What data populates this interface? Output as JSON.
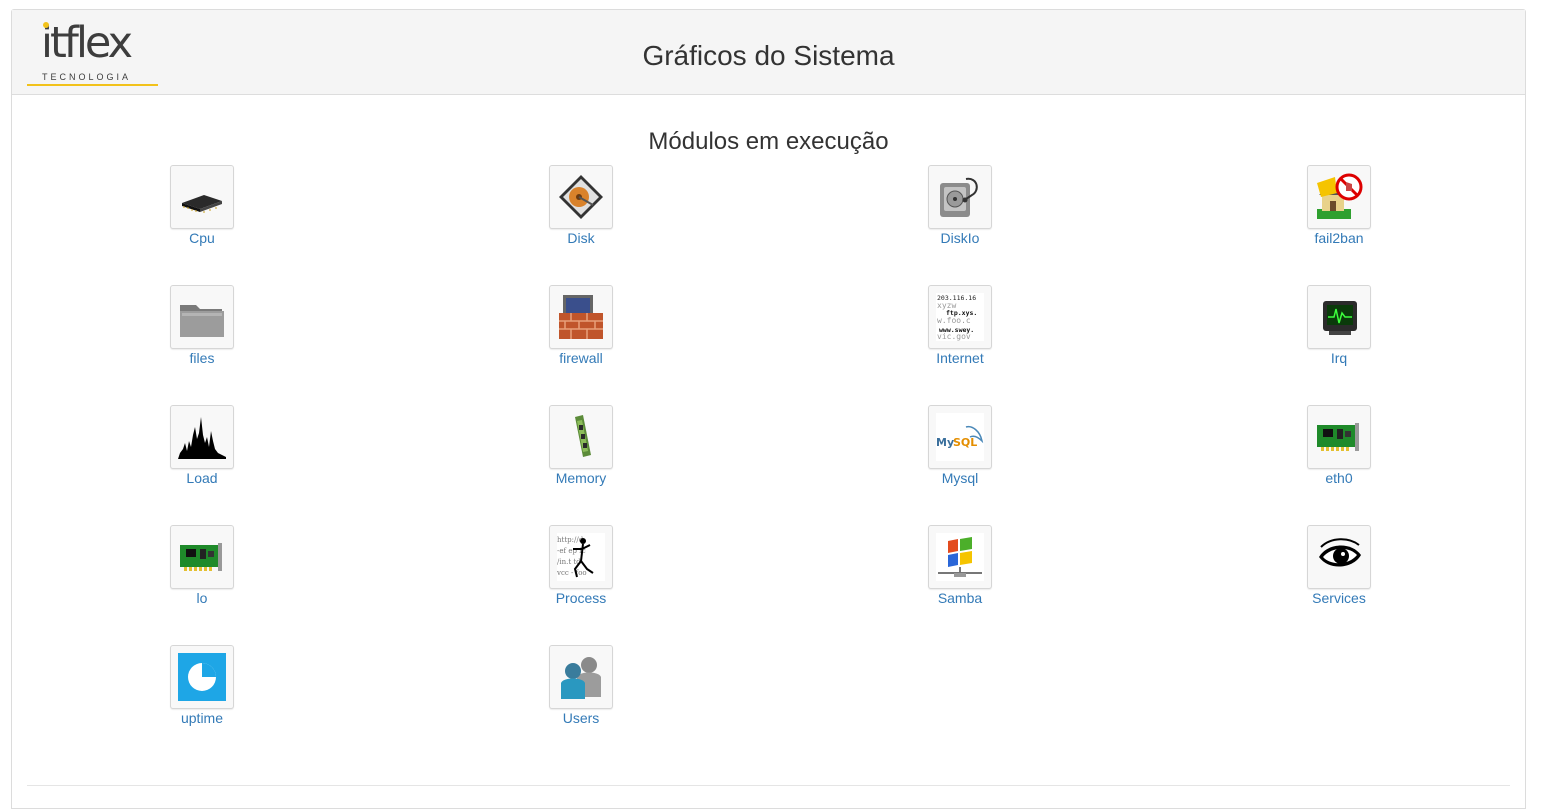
{
  "logo": {
    "brand": "itflex",
    "sub": "TECNOLOGIA"
  },
  "header": {
    "title": "Gráficos do Sistema"
  },
  "section": {
    "title": "Módulos em execução"
  },
  "modules": [
    {
      "label": "Cpu",
      "icon": "cpu-chip-icon"
    },
    {
      "label": "Disk",
      "icon": "hard-disk-icon"
    },
    {
      "label": "DiskIo",
      "icon": "disk-stethoscope-icon"
    },
    {
      "label": "fail2ban",
      "icon": "house-blocked-icon"
    },
    {
      "label": "files",
      "icon": "folder-icon"
    },
    {
      "label": "firewall",
      "icon": "firewall-icon"
    },
    {
      "label": "Internet",
      "icon": "internet-hosts-icon"
    },
    {
      "label": "Irq",
      "icon": "monitor-icon"
    },
    {
      "label": "Load",
      "icon": "load-graph-icon"
    },
    {
      "label": "Memory",
      "icon": "memory-stick-icon"
    },
    {
      "label": "Mysql",
      "icon": "mysql-icon"
    },
    {
      "label": "eth0",
      "icon": "network-card-icon"
    },
    {
      "label": "lo",
      "icon": "network-card-icon"
    },
    {
      "label": "Process",
      "icon": "process-runner-icon"
    },
    {
      "label": "Samba",
      "icon": "samba-windows-icon"
    },
    {
      "label": "Services",
      "icon": "eye-icon"
    },
    {
      "label": "uptime",
      "icon": "uptime-clock-icon"
    },
    {
      "label": "Users",
      "icon": "users-icon"
    }
  ],
  "colors": {
    "link": "#337ab7",
    "accent": "#f2c21b",
    "heading_bg": "#f5f5f5"
  }
}
